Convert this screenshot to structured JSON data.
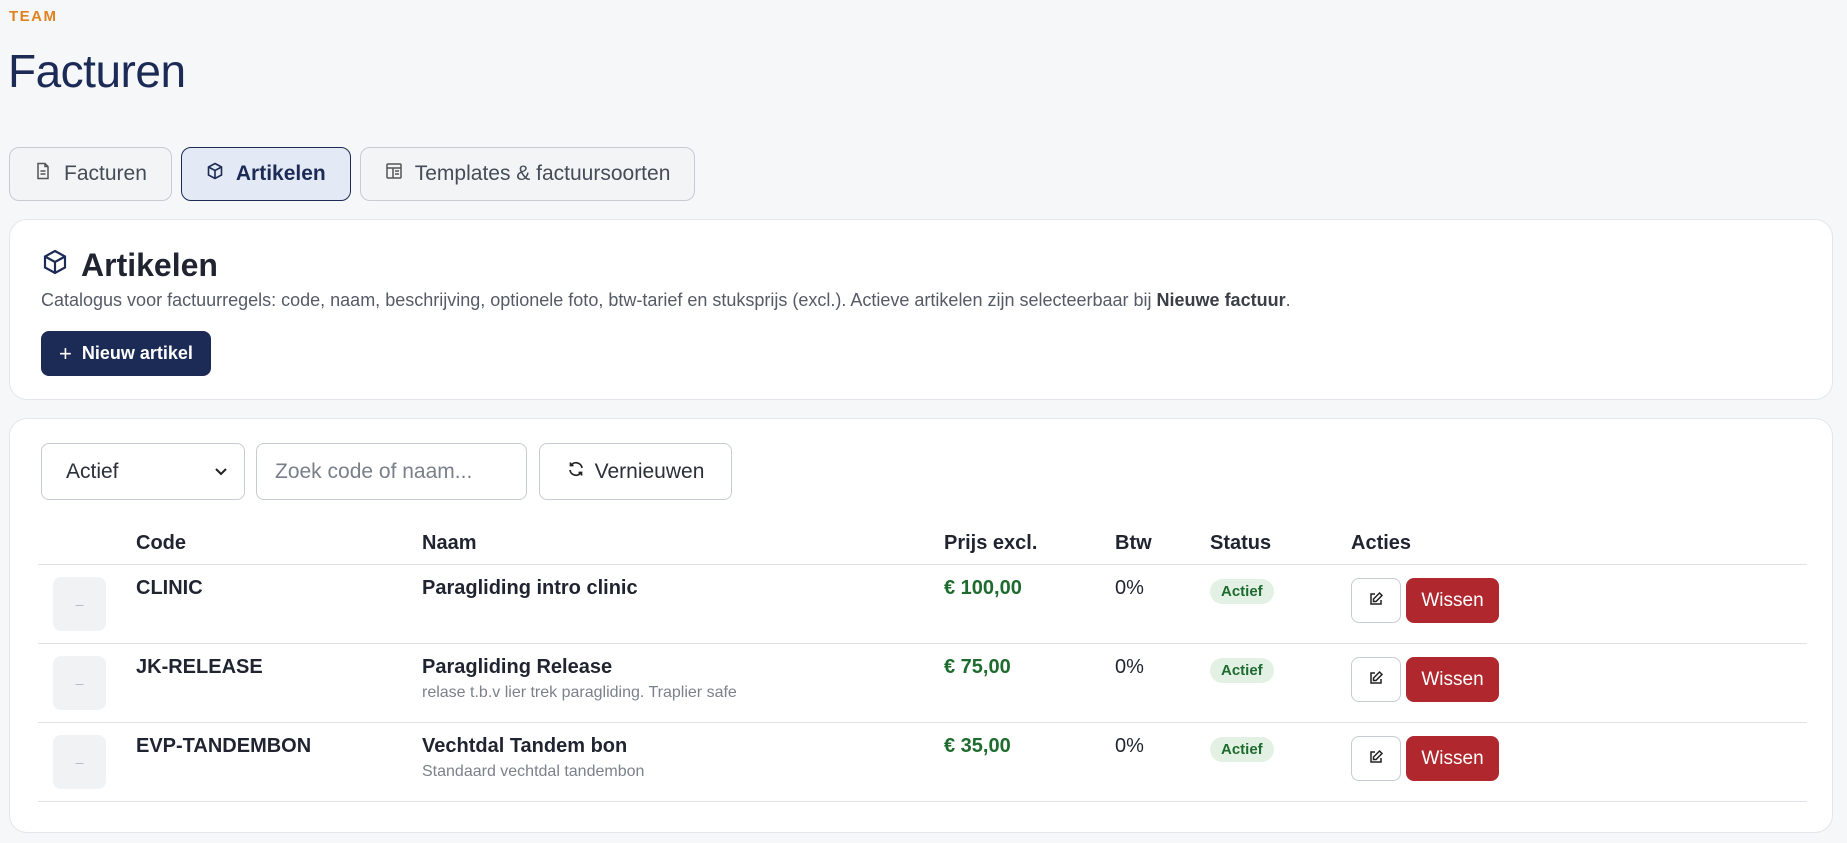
{
  "header": {
    "eyebrow": "TEAM",
    "title": "Facturen"
  },
  "tabs": [
    {
      "label": "Facturen",
      "icon": "document-icon",
      "active": false
    },
    {
      "label": "Artikelen",
      "icon": "box-icon",
      "active": true
    },
    {
      "label": "Templates & factuursoorten",
      "icon": "template-icon",
      "active": false
    }
  ],
  "section": {
    "title": "Artikelen",
    "description_prefix": "Catalogus voor factuurregels: code, naam, beschrijving, optionele foto, btw-tarief en stuksprijs (excl.). Actieve artikelen zijn selecteerbaar bij ",
    "description_bold": "Nieuwe factuur",
    "description_suffix": ".",
    "new_button": "Nieuw artikel"
  },
  "filters": {
    "status_value": "Actief",
    "search_placeholder": "Zoek code of naam...",
    "refresh_label": "Vernieuwen"
  },
  "table": {
    "columns": {
      "code": "Code",
      "naam": "Naam",
      "prijs": "Prijs excl.",
      "btw": "Btw",
      "status": "Status",
      "acties": "Acties"
    },
    "rows": [
      {
        "thumb": "–",
        "code": "CLINIC",
        "naam": "Paragliding intro clinic",
        "sub": "",
        "prijs": "€ 100,00",
        "btw": "0%",
        "status": "Actief",
        "delete": "Wissen"
      },
      {
        "thumb": "–",
        "code": "JK-RELEASE",
        "naam": "Paragliding Release",
        "sub": "relase t.b.v lier trek paragliding. Traplier safe",
        "prijs": "€ 75,00",
        "btw": "0%",
        "status": "Actief",
        "delete": "Wissen"
      },
      {
        "thumb": "–",
        "code": "EVP-TANDEMBON",
        "naam": "Vechtdal Tandem bon",
        "sub": "Standaard vechtdal tandembon",
        "prijs": "€ 35,00",
        "btw": "0%",
        "status": "Actief",
        "delete": "Wissen"
      }
    ]
  },
  "colors": {
    "accent": "#e0821e",
    "primary": "#1c2b55",
    "price": "#1e6b2e",
    "danger": "#b0282e"
  }
}
